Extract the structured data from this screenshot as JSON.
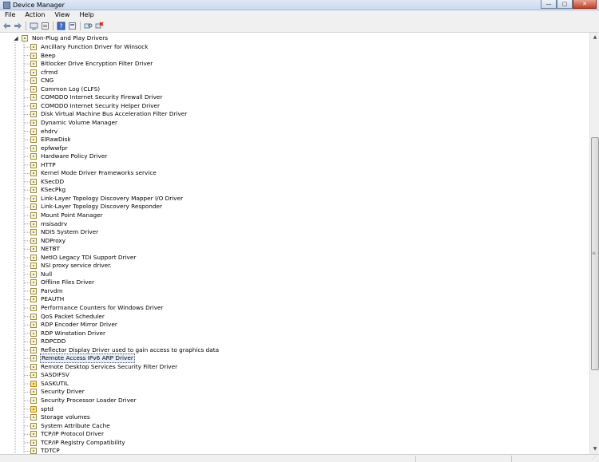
{
  "window": {
    "title": "Device Manager",
    "buttons": {
      "minimize": "—",
      "maximize": "▢",
      "close": "✕"
    }
  },
  "menu": [
    "File",
    "Action",
    "View",
    "Help"
  ],
  "toolbar": {
    "icons": [
      "back-icon",
      "forward-icon",
      "computer-view-icon",
      "properties-icon",
      "help-icon",
      "show-hidden-icon",
      "scan-hardware-icon",
      "uninstall-icon"
    ]
  },
  "tree": {
    "root": {
      "expander": "◢",
      "label": "Non-Plug and Play Drivers"
    },
    "selected_index": 37,
    "items": [
      {
        "label": "Ancillary Function Driver for Winsock",
        "warn": false
      },
      {
        "label": "Beep",
        "warn": false
      },
      {
        "label": "Bitlocker Drive Encryption Filter Driver",
        "warn": false
      },
      {
        "label": "cfrmd",
        "warn": false
      },
      {
        "label": "CNG",
        "warn": false
      },
      {
        "label": "Common Log (CLFS)",
        "warn": false
      },
      {
        "label": "COMODO Internet Security Firewall Driver",
        "warn": false
      },
      {
        "label": "COMODO Internet Security Helper Driver",
        "warn": false
      },
      {
        "label": "Disk Virtual Machine Bus Acceleration Filter Driver",
        "warn": false
      },
      {
        "label": "Dynamic Volume Manager",
        "warn": false
      },
      {
        "label": "ehdrv",
        "warn": false
      },
      {
        "label": "ElRawDisk",
        "warn": false
      },
      {
        "label": "epfwwfpr",
        "warn": false
      },
      {
        "label": "Hardware Policy Driver",
        "warn": false
      },
      {
        "label": "HTTP",
        "warn": false
      },
      {
        "label": "Kernel Mode Driver Frameworks service",
        "warn": false
      },
      {
        "label": "KSecDD",
        "warn": false
      },
      {
        "label": "KSecPkg",
        "warn": false
      },
      {
        "label": "Link-Layer Topology Discovery Mapper I/O Driver",
        "warn": false
      },
      {
        "label": "Link-Layer Topology Discovery Responder",
        "warn": false
      },
      {
        "label": "Mount Point Manager",
        "warn": false
      },
      {
        "label": "msisadrv",
        "warn": false
      },
      {
        "label": "NDIS System Driver",
        "warn": false
      },
      {
        "label": "NDProxy",
        "warn": false
      },
      {
        "label": "NETBT",
        "warn": false
      },
      {
        "label": "NetIO Legacy TDI Support Driver",
        "warn": false
      },
      {
        "label": "NSI proxy service driver.",
        "warn": false
      },
      {
        "label": "Null",
        "warn": false
      },
      {
        "label": "Offline Files Driver",
        "warn": false
      },
      {
        "label": "Parvdm",
        "warn": false
      },
      {
        "label": "PEAUTH",
        "warn": false
      },
      {
        "label": "Performance Counters for Windows Driver",
        "warn": false
      },
      {
        "label": "QoS Packet Scheduler",
        "warn": false
      },
      {
        "label": "RDP Encoder Mirror Driver",
        "warn": false
      },
      {
        "label": "RDP Winstation Driver",
        "warn": false
      },
      {
        "label": "RDPCDD",
        "warn": false
      },
      {
        "label": "Reflector Display Driver used to gain access to graphics data",
        "warn": false
      },
      {
        "label": "Remote Access IPv6 ARP Driver",
        "warn": false
      },
      {
        "label": "Remote Desktop Services Security Filter Driver",
        "warn": false
      },
      {
        "label": "SASDIFSV",
        "warn": false
      },
      {
        "label": "SASKUTIL",
        "warn": true
      },
      {
        "label": "Security Driver",
        "warn": false
      },
      {
        "label": "Security Processor Loader Driver",
        "warn": false
      },
      {
        "label": "sptd",
        "warn": true
      },
      {
        "label": "Storage volumes",
        "warn": false
      },
      {
        "label": "System Attribute Cache",
        "warn": false
      },
      {
        "label": "TCP/IP Protocol Driver",
        "warn": false
      },
      {
        "label": "TCP/IP Registry Compatibility",
        "warn": false
      },
      {
        "label": "TDTCP",
        "warn": false
      }
    ]
  },
  "scrollbar": {
    "up": "▲",
    "down": "▼",
    "grip": "≡"
  }
}
